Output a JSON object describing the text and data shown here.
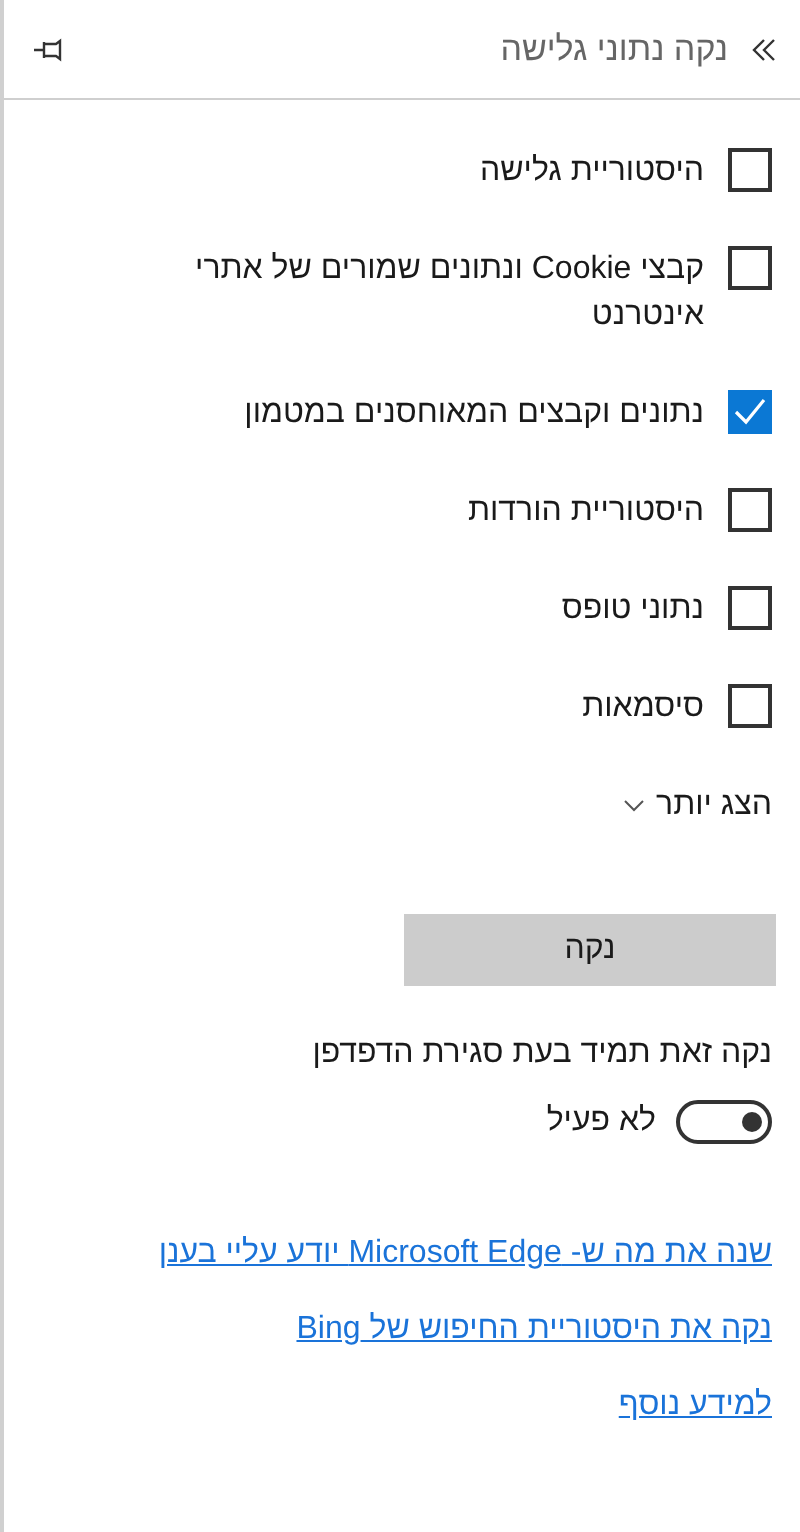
{
  "header": {
    "title": "נקה נתוני גלישה"
  },
  "options": [
    {
      "label": "היסטוריית גלישה",
      "checked": false
    },
    {
      "label": "קבצי Cookie ונתונים שמורים של אתרי אינטרנט",
      "checked": false
    },
    {
      "label": "נתונים וקבצים המאוחסנים במטמון",
      "checked": true
    },
    {
      "label": "היסטוריית הורדות",
      "checked": false
    },
    {
      "label": "נתוני טופס",
      "checked": false
    },
    {
      "label": "סיסמאות",
      "checked": false
    }
  ],
  "show_more": "הצג יותר",
  "clear_button": "נקה",
  "always_clear": {
    "label": "נקה זאת תמיד בעת סגירת הדפדפן",
    "on": false,
    "state_text": "לא פעיל"
  },
  "links": [
    "שנה את מה ש- Microsoft Edge יודע עליי בענן",
    "נקה את היסטוריית החיפוש של Bing",
    "למידע נוסף"
  ]
}
